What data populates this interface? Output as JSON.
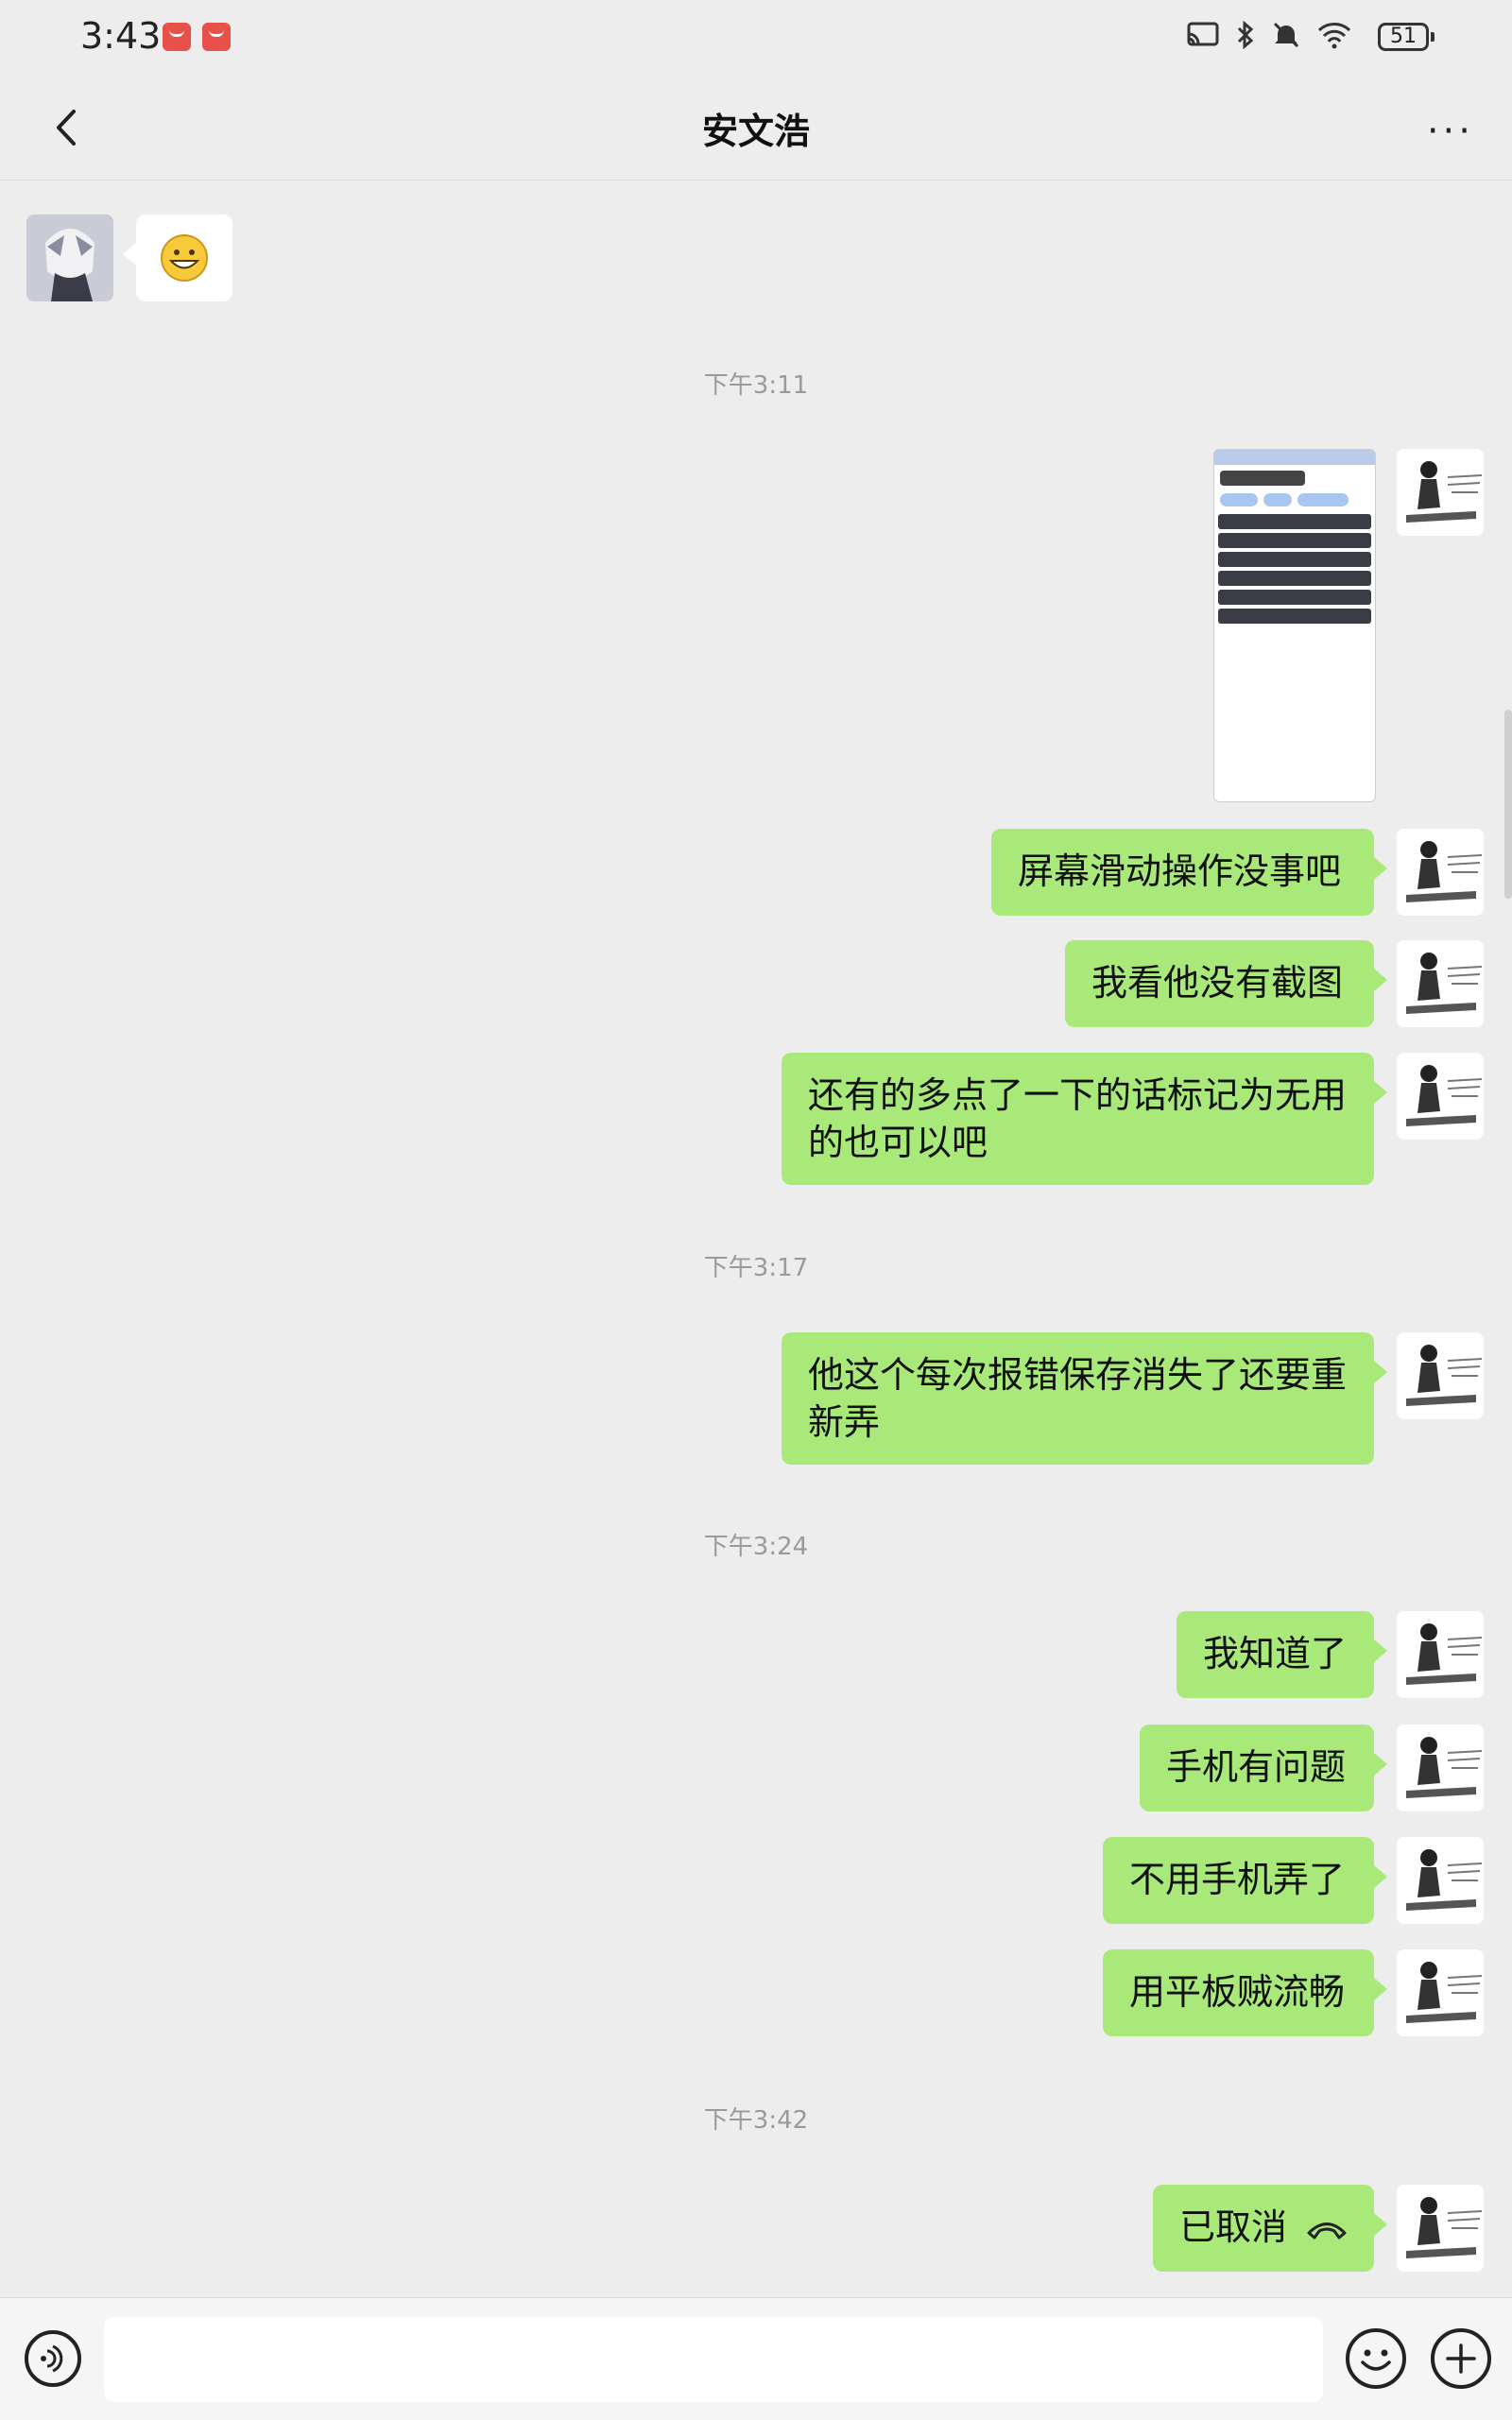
{
  "status_bar": {
    "time": "3:43",
    "battery": "51",
    "icons": [
      "cast-icon",
      "bluetooth-icon",
      "mute-icon",
      "wifi-icon"
    ]
  },
  "header": {
    "title": "安文浩",
    "back_icon": "chevron-left-icon",
    "more_label": "···"
  },
  "timestamps": [
    "下午3:11",
    "下午3:17",
    "下午3:24",
    "下午3:42"
  ],
  "messages": [
    {
      "from": "other",
      "type": "sticker",
      "content": "grinning-face-emoji"
    },
    {
      "from": "me",
      "type": "image",
      "content": "screenshot-thumbnail"
    },
    {
      "from": "me",
      "type": "text",
      "content": "屏幕滑动操作没事吧"
    },
    {
      "from": "me",
      "type": "text",
      "content": "我看他没有截图"
    },
    {
      "from": "me",
      "type": "text",
      "content": "还有的多点了一下的话标记为无用的也可以吧"
    },
    {
      "from": "me",
      "type": "text",
      "content": "他这个每次报错保存消失了还要重新弄"
    },
    {
      "from": "me",
      "type": "text",
      "content": "我知道了"
    },
    {
      "from": "me",
      "type": "text",
      "content": "手机有问题"
    },
    {
      "from": "me",
      "type": "text",
      "content": "不用手机弄了"
    },
    {
      "from": "me",
      "type": "text",
      "content": "用平板贼流畅"
    },
    {
      "from": "me",
      "type": "call",
      "content": "已取消"
    }
  ],
  "input_bar": {
    "input_value": "",
    "voice_icon": "voice-icon",
    "emoji_icon": "smiley-icon",
    "plus_icon": "plus-icon"
  },
  "colors": {
    "background": "#ededed",
    "my_bubble": "#a9e97a",
    "other_bubble": "#ffffff",
    "timestamp": "#9a9a9a"
  }
}
